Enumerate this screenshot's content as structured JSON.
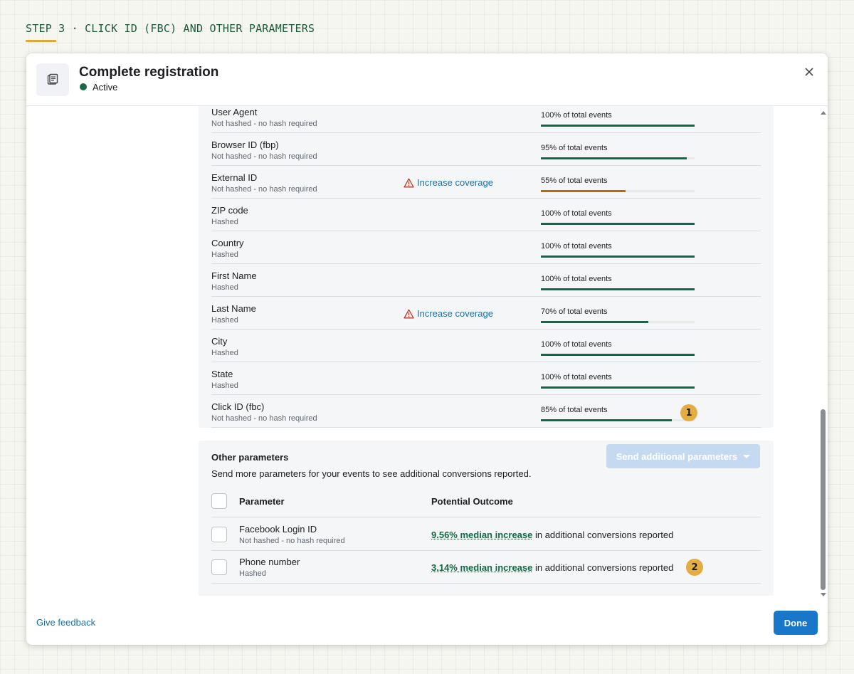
{
  "step": {
    "label": "STEP 3 · CLICK ID (FBC) AND OTHER PARAMETERS"
  },
  "modal": {
    "title": "Complete registration",
    "status": "Active",
    "status_color": "#1a6b45",
    "header_icon": "event-page-icon",
    "close_icon": "close-icon"
  },
  "parameters": [
    {
      "name": "User Agent",
      "hash": "Not hashed - no hash required",
      "coverage_pct": 100,
      "label": "100% of total events",
      "warning": ""
    },
    {
      "name": "Browser ID (fbp)",
      "hash": "Not hashed - no hash required",
      "coverage_pct": 95,
      "label": "95% of total events",
      "warning": ""
    },
    {
      "name": "External ID",
      "hash": "Not hashed - no hash required",
      "coverage_pct": 55,
      "label": "55% of total events",
      "warning": "Increase coverage"
    },
    {
      "name": "ZIP code",
      "hash": "Hashed",
      "coverage_pct": 100,
      "label": "100% of total events",
      "warning": ""
    },
    {
      "name": "Country",
      "hash": "Hashed",
      "coverage_pct": 100,
      "label": "100% of total events",
      "warning": ""
    },
    {
      "name": "First Name",
      "hash": "Hashed",
      "coverage_pct": 100,
      "label": "100% of total events",
      "warning": ""
    },
    {
      "name": "Last Name",
      "hash": "Hashed",
      "coverage_pct": 70,
      "label": "70% of total events",
      "warning": "Increase coverage"
    },
    {
      "name": "City",
      "hash": "Hashed",
      "coverage_pct": 100,
      "label": "100% of total events",
      "warning": ""
    },
    {
      "name": "State",
      "hash": "Hashed",
      "coverage_pct": 100,
      "label": "100% of total events",
      "warning": ""
    },
    {
      "name": "Click ID (fbc)",
      "hash": "Not hashed - no hash required",
      "coverage_pct": 85,
      "label": "85% of total events",
      "warning": ""
    }
  ],
  "colors": {
    "bar_ok": "#0d6b45",
    "bar_warn": "#b56a12",
    "warning_icon": "#c0392b",
    "link": "#1d6fa5",
    "badge": "#e3ad43"
  },
  "badges": {
    "one": "1",
    "two": "2"
  },
  "other": {
    "title": "Other parameters",
    "description": "Send more parameters for your events to see additional conversions reported.",
    "send_button": "Send additional parameters",
    "col_parameter": "Parameter",
    "col_outcome": "Potential Outcome",
    "rows": [
      {
        "name": "Facebook Login ID",
        "hash": "Not hashed - no hash required",
        "increase": "9.56% median increase",
        "suffix": " in additional conversions reported"
      },
      {
        "name": "Phone number",
        "hash": "Hashed",
        "increase": "3.14% median increase",
        "suffix": " in additional conversions reported"
      }
    ]
  },
  "footer": {
    "feedback": "Give feedback",
    "done": "Done"
  }
}
